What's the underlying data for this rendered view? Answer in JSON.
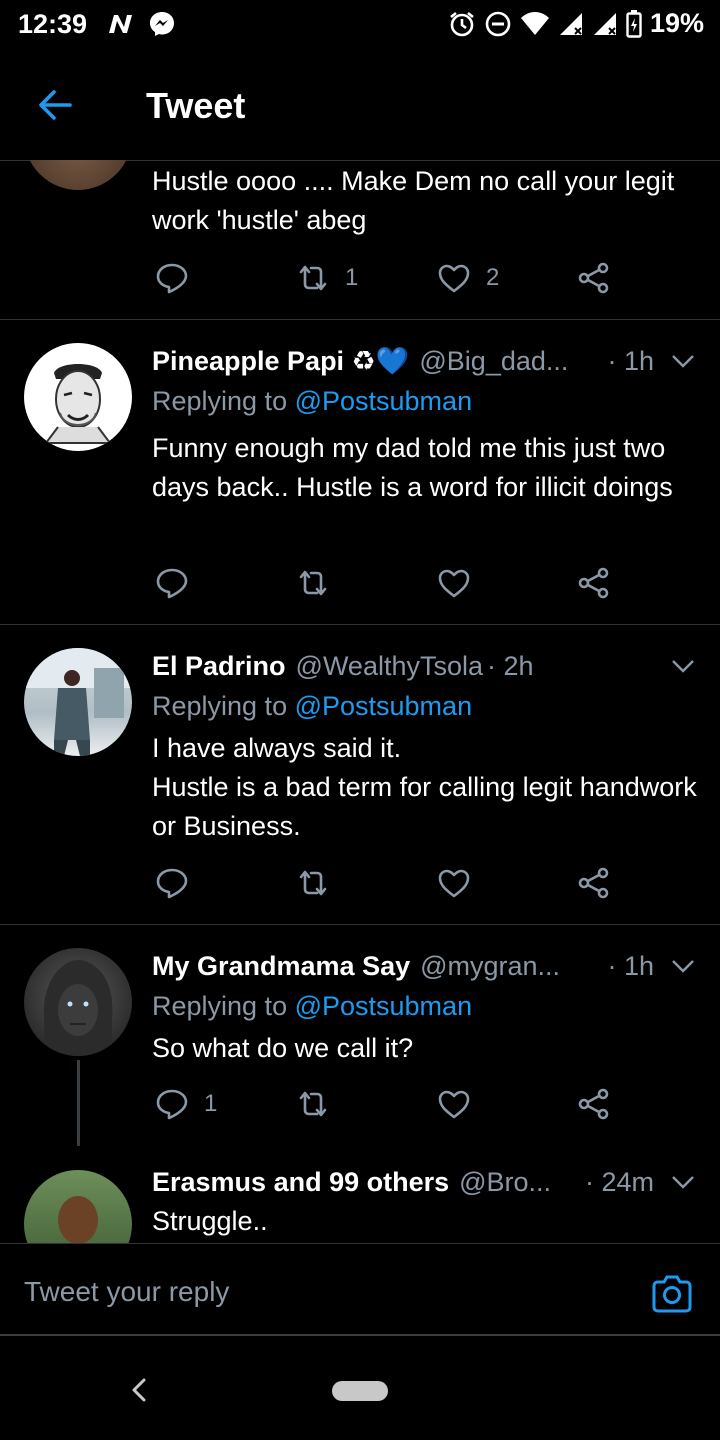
{
  "status_bar": {
    "time": "12:39",
    "battery": "19%",
    "left_icons": [
      "n-icon",
      "messenger-icon"
    ],
    "right_icons": [
      "alarm-icon",
      "dnd-icon",
      "wifi-icon",
      "signal-icon",
      "signal-icon",
      "battery-icon"
    ]
  },
  "app_bar": {
    "title": "Tweet"
  },
  "tweets": [
    {
      "body": "Hustle oooo .... Make Dem no call your legit work 'hustle' abeg",
      "reply_count": "",
      "retweet_count": "1",
      "like_count": "2"
    },
    {
      "name": "Pineapple Papi ♻💙",
      "handle": "@Big_dad...",
      "time": "· 1h",
      "replying_prefix": "Replying to ",
      "replying_to": "@Postsubman",
      "body": "Funny enough my dad told me this just two days back.. Hustle is a word for illicit doings",
      "reply_count": "",
      "retweet_count": "",
      "like_count": ""
    },
    {
      "name": "El Padrino",
      "handle": "@WealthyTsola",
      "time": "· 2h",
      "replying_prefix": "Replying to ",
      "replying_to": "@Postsubman",
      "body": "I have always said it.\nHustle is a bad term for calling legit handwork or Business.",
      "reply_count": "",
      "retweet_count": "",
      "like_count": ""
    },
    {
      "name": "My Grandmama Say",
      "handle": "@mygran...",
      "time": "· 1h",
      "replying_prefix": "Replying to ",
      "replying_to": "@Postsubman",
      "body": "So what do we call it?",
      "reply_count": "1",
      "retweet_count": "",
      "like_count": ""
    },
    {
      "name": "Erasmus and 99 others",
      "handle": "@Bro...",
      "time": "· 24m",
      "body": "Struggle.."
    }
  ],
  "reply_bar": {
    "placeholder": "Tweet your reply"
  },
  "colors": {
    "background": "#000000",
    "accent": "#1d9bf0",
    "secondary_text": "#8b98a5",
    "divider": "#2f3336"
  }
}
